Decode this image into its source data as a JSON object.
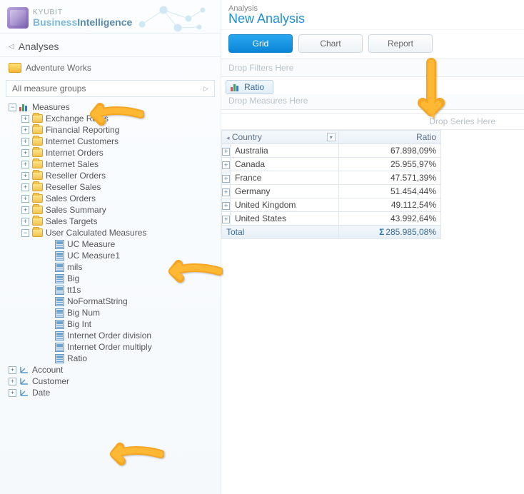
{
  "brand": {
    "k": "KYUBIT",
    "b1": "Business",
    "b2": "Intelligence"
  },
  "panel_title": "Analyses",
  "cube_title": "Adventure Works",
  "measure_groups": "All measure groups",
  "measures_label": "Measures",
  "folders": [
    "Exchange Rates",
    "Financial Reporting",
    "Internet Customers",
    "Internet Orders",
    "Internet Sales",
    "Reseller Orders",
    "Reseller Sales",
    "Sales Orders",
    "Sales Summary",
    "Sales Targets"
  ],
  "ucm": {
    "label": "User Calculated Measures",
    "items": [
      "UC Measure",
      "UC Measure1",
      "mils",
      "Big",
      "tt1s",
      "NoFormatString",
      "Big Num",
      "Big Int",
      "Internet Order division",
      "Internet Order multiply",
      "Ratio"
    ]
  },
  "dims": [
    "Account",
    "Customer",
    "Date"
  ],
  "analysis": {
    "small": "Analysis",
    "title": "New Analysis"
  },
  "tabs": {
    "grid": "Grid",
    "chart": "Chart",
    "report": "Report"
  },
  "drop": {
    "filters": "Drop Filters Here",
    "measures": "Drop Measures Here",
    "series": "Drop Series Here"
  },
  "measure_chip": "Ratio",
  "headers": {
    "country": "Country",
    "ratio": "Ratio"
  },
  "chart_data": {
    "type": "table",
    "columns": [
      "Country",
      "Ratio"
    ],
    "rows": [
      {
        "country": "Australia",
        "ratio": "67.898,09%"
      },
      {
        "country": "Canada",
        "ratio": "25.955,97%"
      },
      {
        "country": "France",
        "ratio": "47.571,39%"
      },
      {
        "country": "Germany",
        "ratio": "51.454,44%"
      },
      {
        "country": "United Kingdom",
        "ratio": "49.112,54%"
      },
      {
        "country": "United States",
        "ratio": "43.992,64%"
      }
    ],
    "total": {
      "label": "Total",
      "value": "285.985,08%"
    }
  }
}
